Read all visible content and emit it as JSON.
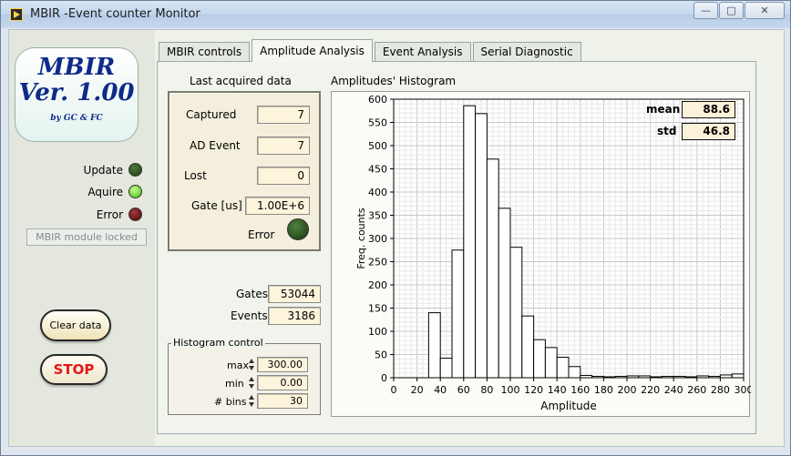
{
  "window": {
    "title": "MBIR -Event counter Monitor"
  },
  "logo": {
    "line1": "MBIR",
    "line2": "Ver. 1.00",
    "line3": "by GC & FC"
  },
  "status": {
    "update_label": "Update",
    "aquire_label": "Aquire",
    "error_label": "Error",
    "locked_text": "MBIR module locked"
  },
  "buttons": {
    "clear": "Clear data",
    "stop": "STOP"
  },
  "tabs": [
    "MBIR controls",
    "Amplitude Analysis",
    "Event Analysis",
    "Serial Diagnostic"
  ],
  "last_acquired": {
    "title": "Last acquired data",
    "captured_label": "Captured",
    "captured": "7",
    "ad_event_label": "AD Event",
    "ad_event": "7",
    "lost_label": "Lost",
    "lost": "0",
    "gate_label": "Gate [us]",
    "gate": "1.00E+6",
    "error_label": "Error"
  },
  "counters": {
    "gates_label": "Gates",
    "gates": "53044",
    "events_label": "Events",
    "events": "3186"
  },
  "histogram_control": {
    "title": "Histogram control",
    "max_label": "max",
    "max": "300.00",
    "min_label": "min",
    "min": "0.00",
    "bins_label": "# bins",
    "bins": "30"
  },
  "stats": {
    "mean_label": "mean",
    "mean": "88.6",
    "std_label": "std",
    "std": "46.8"
  },
  "colors": {
    "stop_text": "#e31818",
    "led_on": "#3dbb10",
    "logo_text": "#0f2a8a"
  },
  "chart_data": {
    "type": "bar",
    "title": "Amplitudes' Histogram",
    "xlabel": "Amplitude",
    "ylabel": "Freq. counts",
    "xlim": [
      0,
      300
    ],
    "ylim": [
      0,
      600
    ],
    "xticks": [
      0,
      20,
      40,
      60,
      80,
      100,
      120,
      140,
      160,
      180,
      200,
      220,
      240,
      260,
      280,
      300
    ],
    "yticks": [
      0,
      50,
      100,
      150,
      200,
      250,
      300,
      350,
      400,
      450,
      500,
      550,
      600
    ],
    "grid": true,
    "bin_width": 10,
    "bin_starts": [
      0,
      10,
      20,
      30,
      40,
      50,
      60,
      70,
      80,
      90,
      100,
      110,
      120,
      130,
      140,
      150,
      160,
      170,
      180,
      190,
      200,
      210,
      220,
      230,
      240,
      250,
      260,
      270,
      280,
      290
    ],
    "values": [
      0,
      0,
      0,
      140,
      42,
      275,
      586,
      569,
      471,
      365,
      281,
      133,
      82,
      65,
      44,
      24,
      5,
      3,
      2,
      3,
      4,
      4,
      2,
      3,
      3,
      2,
      4,
      3,
      6,
      8
    ]
  }
}
